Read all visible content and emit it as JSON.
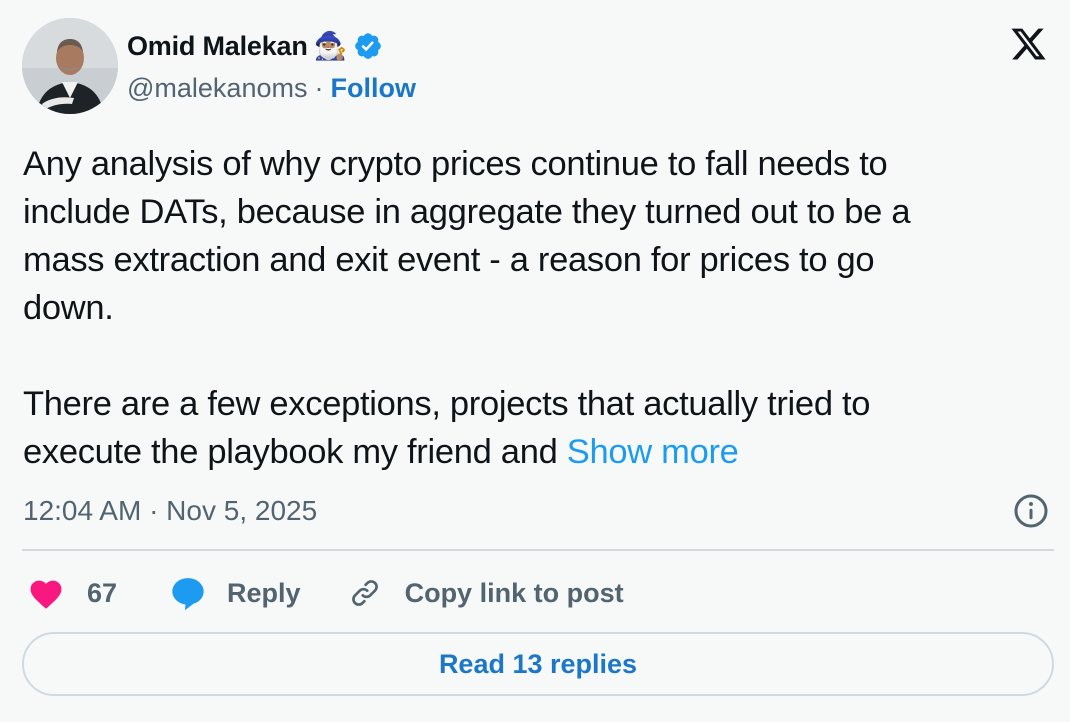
{
  "author": {
    "name": "Omid Malekan",
    "name_emoji": "🧙🏽‍♂️",
    "handle": "@malekanoms",
    "separator": "·",
    "follow_label": "Follow",
    "avatar_icon": "profile-photo",
    "verified_icon": "verified-badge-icon"
  },
  "platform_icon": "x-logo-icon",
  "post": {
    "paragraph1_lines": [
      "Any analysis of why crypto prices continue to fall needs to",
      "include DATs, because in aggregate they turned out to be a",
      "mass extraction and exit event - a reason for prices to go",
      "down."
    ],
    "paragraph2_lines": [
      "There are a few exceptions, projects that actually tried to",
      "execute the playbook my friend and"
    ],
    "show_more_label": "Show more",
    "timestamp": "12:04 AM · Nov 5, 2025",
    "info_icon": "info-icon"
  },
  "actions": {
    "like_count": "67",
    "reply_label": "Reply",
    "copy_link_label": "Copy link to post"
  },
  "read_replies_label": "Read 13 replies",
  "colors": {
    "background": "#f7f9f9",
    "text": "#0f1419",
    "secondary": "#536471",
    "link": "#1d9bf0",
    "link_bold": "#1d77c9",
    "like": "#f91880",
    "verified": "#1d9bf0",
    "border": "#cfd9de"
  }
}
